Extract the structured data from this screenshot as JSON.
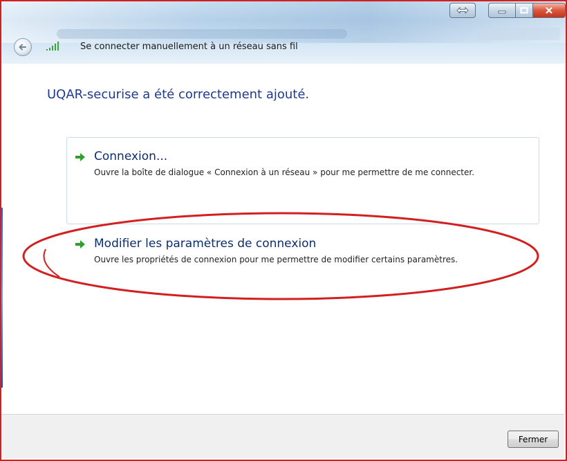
{
  "window": {
    "title": "Se connecter manuellement à un réseau sans fil"
  },
  "content": {
    "heading": "UQAR-securise a été correctement ajouté.",
    "options": [
      {
        "title": "Connexion...",
        "description": "Ouvre la boîte de dialogue « Connexion à un réseau » pour me permettre de me connecter."
      },
      {
        "title": "Modifier les paramètres de connexion",
        "description": "Ouvre les propriétés de connexion pour me permettre de modifier certains paramètres."
      }
    ]
  },
  "footer": {
    "close_label": "Fermer"
  },
  "colors": {
    "accent_link": "#0c2f6b",
    "heading": "#1e3a8a",
    "arrow": "#2aa22a",
    "highlight_ellipse": "#d21f1f"
  },
  "icons": {
    "back": "back-arrow-icon",
    "wifi": "wireless-signal-icon",
    "option_arrow": "green-arrow-icon"
  }
}
